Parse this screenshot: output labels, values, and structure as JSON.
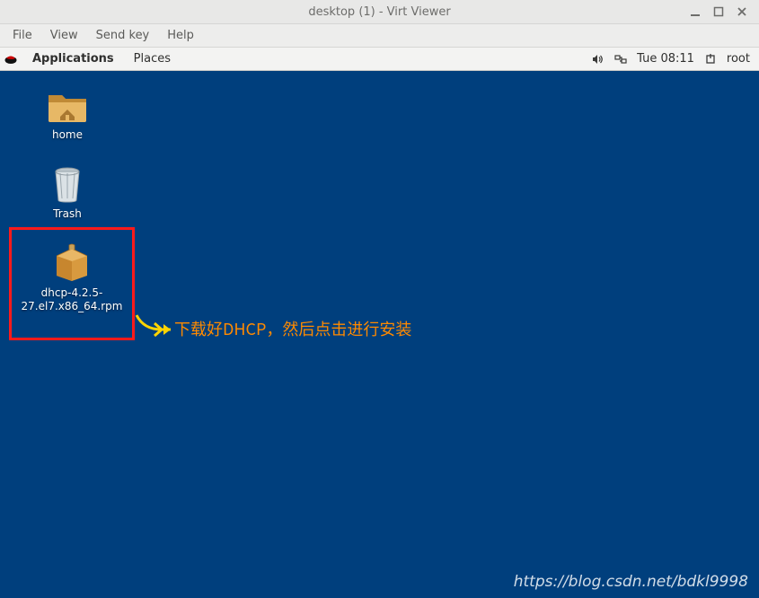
{
  "window": {
    "title": "desktop (1) - Virt Viewer",
    "menu": {
      "file": "File",
      "view": "View",
      "sendkey": "Send key",
      "help": "Help"
    }
  },
  "gnome": {
    "applications": "Applications",
    "places": "Places",
    "clock": "Tue 08:11",
    "user": "root"
  },
  "desktop": {
    "home": {
      "label": "home"
    },
    "trash": {
      "label": "Trash"
    },
    "rpm": {
      "label": "dhcp-4.2.5-27.el7.x86_64.rpm"
    }
  },
  "annotation": {
    "text": "下载好DHCP，然后点击进行安装",
    "color": "#ff8a00"
  },
  "watermark": "https://blog.csdn.net/bdkl9998"
}
